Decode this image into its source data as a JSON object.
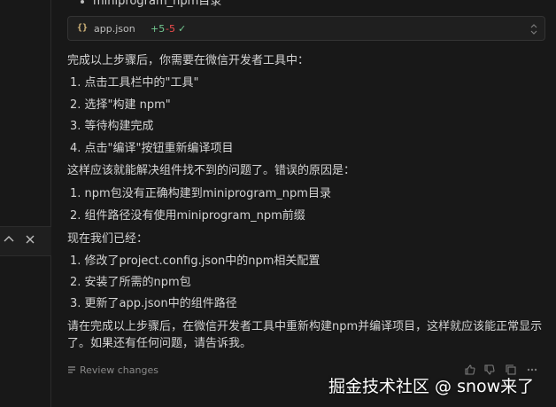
{
  "previous_line": "miniprogram_npm目录",
  "file_chip": {
    "icon": "{}",
    "name": "app.json",
    "additions": "+5",
    "deletions": "-5",
    "status_icon": "✓"
  },
  "intro": "完成以上步骤后，你需要在微信开发者工具中：",
  "steps": [
    "1. 点击工具栏中的\"工具\"",
    "2. 选择\"构建 npm\"",
    "3. 等待构建完成",
    "4. 点击\"编译\"按钮重新编译项目"
  ],
  "cause_intro": "这样应该就能解决组件找不到的问题了。错误的原因是：",
  "causes": [
    "1. npm包没有正确构建到miniprogram_npm目录",
    "2. 组件路径没有使用miniprogram_npm前缀"
  ],
  "now_intro": "现在我们已经：",
  "done": [
    "1. 修改了project.config.json中的npm相关配置",
    "2. 安装了所需的npm包",
    "3. 更新了app.json中的组件路径"
  ],
  "closing_line1": "请在完成以上步骤后，在微信开发者工具中重新构建npm并编译项目，这样就应该能正常显示",
  "closing_line2": "了。如果还有任何问题，请告诉我。",
  "review_label": "Review changes",
  "watermark": "掘金技术社区 @ snow来了"
}
